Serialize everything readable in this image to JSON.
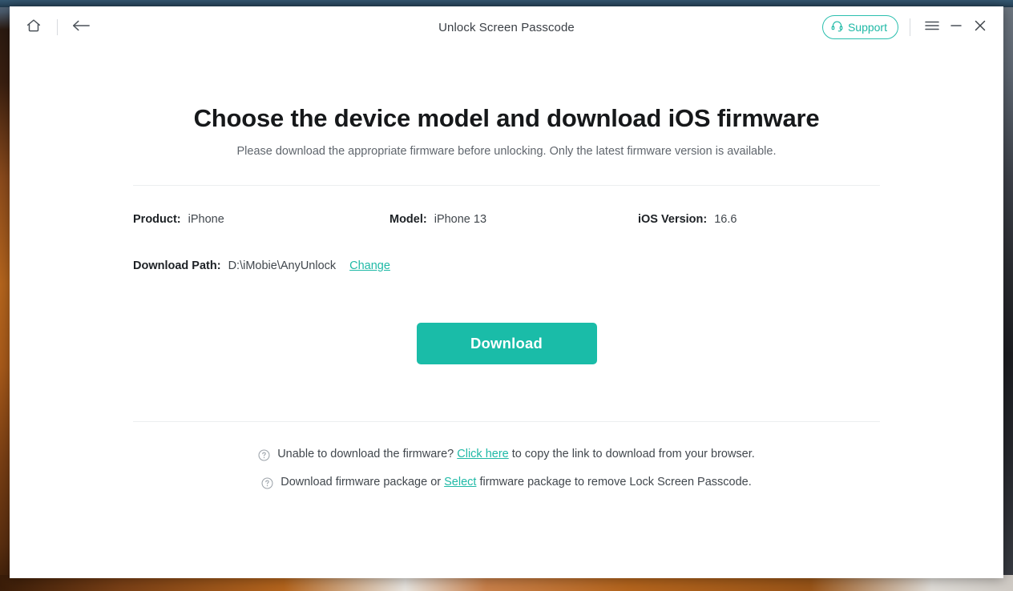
{
  "window": {
    "title": "Unlock Screen Passcode",
    "home_icon": "home-icon",
    "back_icon": "back-arrow-icon",
    "support_label": "Support",
    "support_icon": "headset-icon",
    "menu_icon": "hamburger-menu-icon",
    "minimize_icon": "minimize-icon",
    "close_icon": "close-icon"
  },
  "main": {
    "headline": "Choose the device model and download iOS firmware",
    "subhead": "Please download the appropriate firmware before unlocking. Only the latest firmware version is available.",
    "fields": {
      "product_label": "Product:",
      "product_value": "iPhone",
      "model_label": "Model:",
      "model_value": "iPhone 13",
      "ios_label": "iOS Version:",
      "ios_value": "16.6",
      "path_label": "Download Path:",
      "path_value": "D:\\iMobie\\AnyUnlock",
      "change_link": "Change"
    },
    "download_button": "Download"
  },
  "help": {
    "row1": {
      "icon": "question-mark-circle-icon",
      "part1": "Unable to download the firmware?",
      "link": "Click here",
      "part2": "to copy the link to download from your browser."
    },
    "row2": {
      "icon": "question-mark-circle-icon",
      "part1": "Download firmware package or",
      "link": "Select",
      "part2": "firmware package to remove Lock Screen Passcode."
    }
  },
  "colors": {
    "accent": "#1ABCA8",
    "link": "#1fb9a6",
    "text": "#41474d",
    "heading": "#16181a"
  }
}
